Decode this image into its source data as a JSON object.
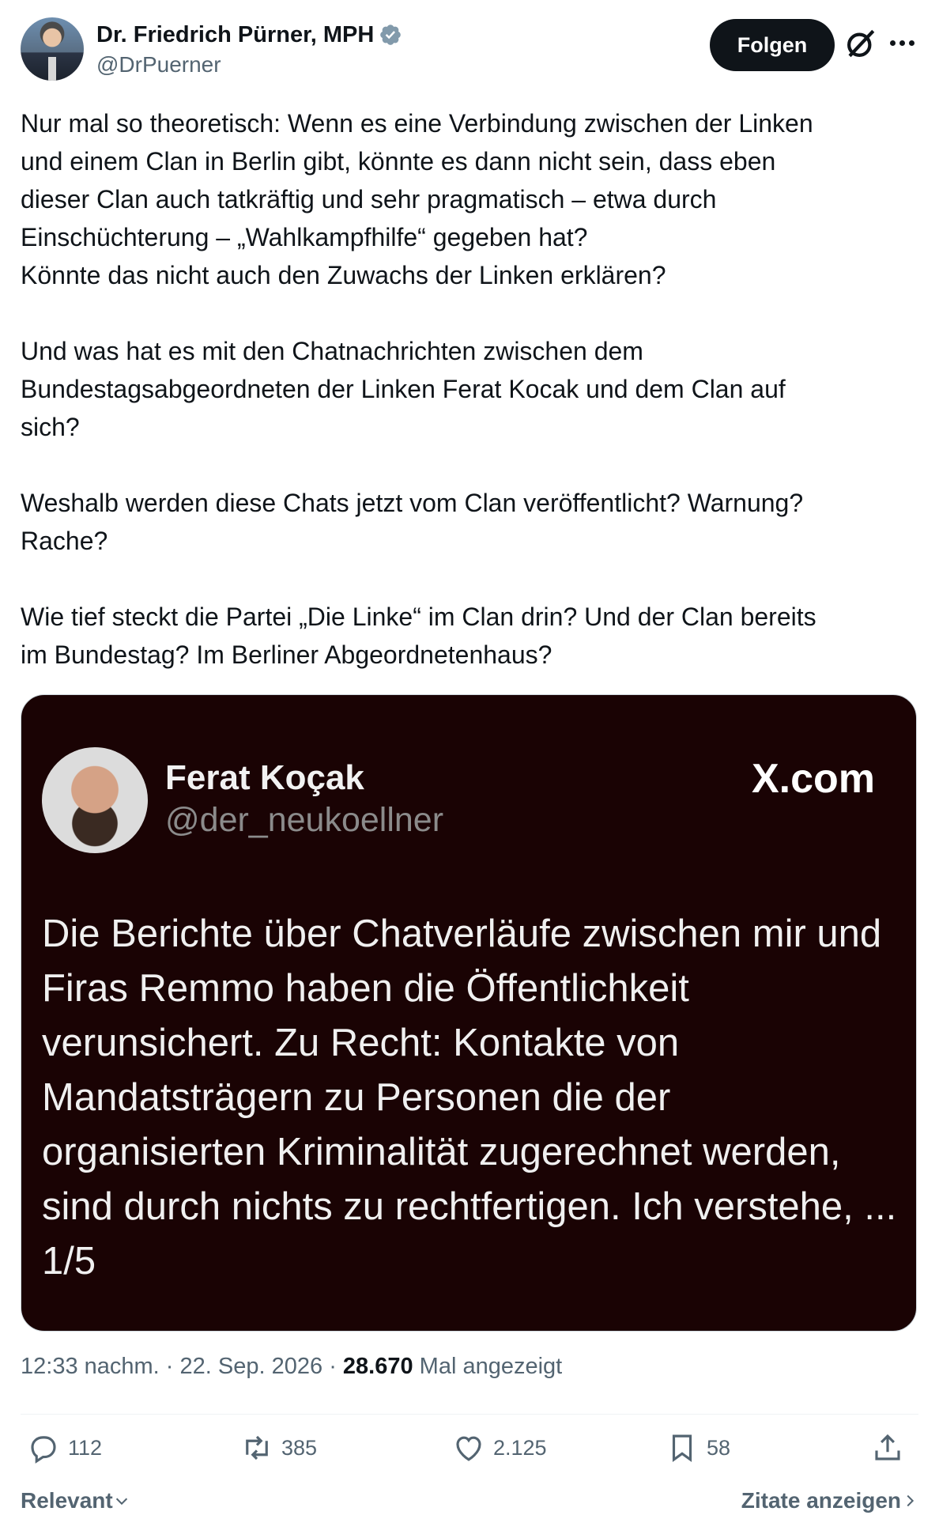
{
  "author": {
    "name": "Dr. Friedrich Pürner, MPH",
    "handle": "@DrPuerner",
    "follow_label": "Folgen"
  },
  "paragraphs": [
    "Nur mal so theoretisch: Wenn es eine Verbindung zwischen der Linken\nund einem Clan in Berlin gibt, könnte es dann nicht sein, dass eben\ndieser Clan auch tatkräftig und sehr pragmatisch – etwa durch\nEinschüchterung – „Wahlkampfhilfe“ gegeben hat?\nKönnte das nicht auch den Zuwachs der Linken erklären?",
    "Und was hat es mit den Chatnachrichten zwischen dem\nBundestagsabgeordneten der Linken Ferat Kocak und dem Clan auf\nsich?",
    "Weshalb werden diese Chats jetzt vom Clan veröffentlicht? Warnung?\nRache?",
    "Wie tief steckt die Partei „Die Linke“ im Clan drin? Und der Clan bereits\nim Bundestag? Im Berliner Abgeordnetenhaus?"
  ],
  "card": {
    "name": "Ferat Koçak",
    "handle": "@der_neukoellner",
    "brand": "X.com",
    "text": "Die Berichte über Chatverläufe zwischen mir und Firas Remmo haben die Öffentlichkeit verunsichert. Zu Recht: Kontakte von Mandatsträgern zu Personen die der organisierten Kriminalität zugerechnet werden, sind durch nichts zu rechtfertigen. Ich verstehe, ... 1/5"
  },
  "meta": {
    "time": "12:33 nachm.",
    "date": "22. Sep. 2026",
    "views": "28.670",
    "views_label": "Mal angezeigt"
  },
  "actions": {
    "replies": "112",
    "reposts": "385",
    "likes": "2.125",
    "bookmarks": "58"
  },
  "footer": {
    "sort_label": "Relevant",
    "quotes_label": "Zitate anzeigen"
  },
  "colors": {
    "follow_bg": "#0f1419",
    "verified": "#829aab",
    "card_bg": "#1a0304",
    "secondary_text": "#536471"
  },
  "icons": [
    "verified-icon",
    "grok-icon",
    "more-icon",
    "reply-icon",
    "repost-icon",
    "like-icon",
    "bookmark-icon",
    "share-icon",
    "chevron-down-icon",
    "chevron-right-icon"
  ]
}
